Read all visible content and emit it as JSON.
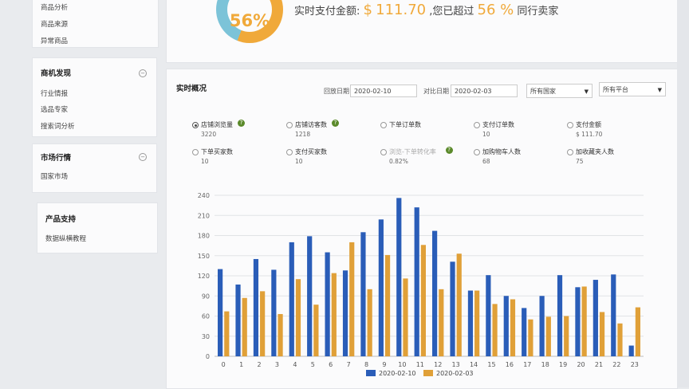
{
  "sidebar": {
    "group1": {
      "items": [
        "商品分析",
        "商品来源",
        "异常商品"
      ]
    },
    "group2": {
      "title": "商机发现",
      "items": [
        "行业情报",
        "选品专家",
        "搜索词分析"
      ]
    },
    "group3": {
      "title": "市场行情",
      "items": [
        "国家市场"
      ]
    },
    "group4": {
      "title": "产品支持",
      "items": [
        "数据纵横教程"
      ]
    }
  },
  "summary": {
    "percent_text": "56%",
    "percent_value": 0.56,
    "pay_label": "实时支付金额:",
    "currency": "$",
    "amount": "111.70",
    "beat_label": ",您已超过",
    "beat_percent": "56 %",
    "peer_label": "同行卖家",
    "colors": {
      "accent": "#f0a93a",
      "remainder": "#7cc3d8"
    }
  },
  "overview": {
    "title": "实时概况",
    "date_label": "回放日期",
    "date_value": "2020-02-10",
    "compare_label": "对比日期",
    "compare_value": "2020-02-03",
    "country_select": "所有国家",
    "platform_select": "所有平台"
  },
  "metrics": [
    {
      "label": "店铺浏览量",
      "value": "3220",
      "help": true,
      "selected": true,
      "disabled": false
    },
    {
      "label": "店铺访客数",
      "value": "1218",
      "help": true,
      "selected": false,
      "disabled": false
    },
    {
      "label": "下单订单数",
      "value": "",
      "help": false,
      "selected": false,
      "disabled": false
    },
    {
      "label": "支付订单数",
      "value": "10",
      "help": false,
      "selected": false,
      "disabled": false
    },
    {
      "label": "支付金额",
      "value": "$ 111.70",
      "help": false,
      "selected": false,
      "disabled": false
    },
    {
      "label": "下单买家数",
      "value": "10",
      "help": false,
      "selected": false,
      "disabled": false
    },
    {
      "label": "支付买家数",
      "value": "10",
      "help": false,
      "selected": false,
      "disabled": false
    },
    {
      "label": "浏览-下单转化率",
      "value": "0.82%",
      "help": true,
      "selected": false,
      "disabled": true
    },
    {
      "label": "加购物车人数",
      "value": "68",
      "help": false,
      "selected": false,
      "disabled": false
    },
    {
      "label": "加收藏夹人数",
      "value": "75",
      "help": false,
      "selected": false,
      "disabled": false
    }
  ],
  "chart_data": {
    "type": "bar",
    "categories": [
      "0",
      "1",
      "2",
      "3",
      "4",
      "5",
      "6",
      "7",
      "8",
      "9",
      "10",
      "11",
      "12",
      "13",
      "14",
      "15",
      "16",
      "17",
      "18",
      "19",
      "20",
      "21",
      "22",
      "23"
    ],
    "series": [
      {
        "name": "2020-02-10",
        "color": "#2a5db8",
        "values": [
          130,
          107,
          145,
          129,
          170,
          179,
          155,
          128,
          185,
          204,
          236,
          222,
          187,
          141,
          98,
          121,
          90,
          72,
          90,
          121,
          103,
          114,
          122,
          16
        ]
      },
      {
        "name": "2020-02-03",
        "color": "#e0a038",
        "values": [
          67,
          87,
          97,
          63,
          115,
          77,
          124,
          170,
          100,
          151,
          116,
          166,
          100,
          153,
          98,
          78,
          85,
          55,
          59,
          60,
          104,
          66,
          49,
          73
        ]
      }
    ],
    "ylim": [
      0,
      240
    ],
    "yticks": [
      0,
      30,
      60,
      90,
      120,
      150,
      180,
      210,
      240
    ],
    "grid": true,
    "legend": "bottom-center"
  }
}
